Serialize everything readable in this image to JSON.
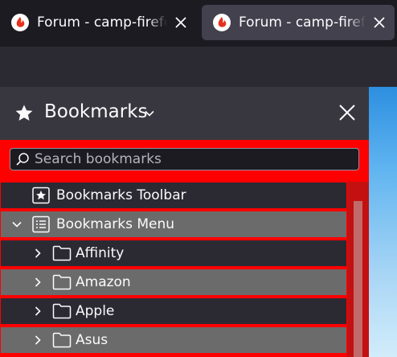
{
  "tabs": [
    {
      "title": "Forum - camp-firefox.de"
    },
    {
      "title": "Forum - camp-firefox.de"
    }
  ],
  "sidebar": {
    "title": "Bookmarks",
    "search_placeholder": "Search bookmarks",
    "items": [
      {
        "label": "Bookmarks Toolbar"
      },
      {
        "label": "Bookmarks Menu"
      },
      {
        "label": "Affinity"
      },
      {
        "label": "Amazon"
      },
      {
        "label": "Apple"
      },
      {
        "label": "Asus"
      }
    ]
  },
  "colors": {
    "highlight": "#ff0000",
    "row_dark": "#2b2a33",
    "row_light": "#6b6b6b"
  },
  "icons": [
    "firefox-favicon",
    "close-icon",
    "star-icon",
    "chevron-down-icon",
    "search-icon",
    "bookmarks-toolbar-icon",
    "bookmarks-menu-icon",
    "folder-icon",
    "chevron-right-icon"
  ]
}
